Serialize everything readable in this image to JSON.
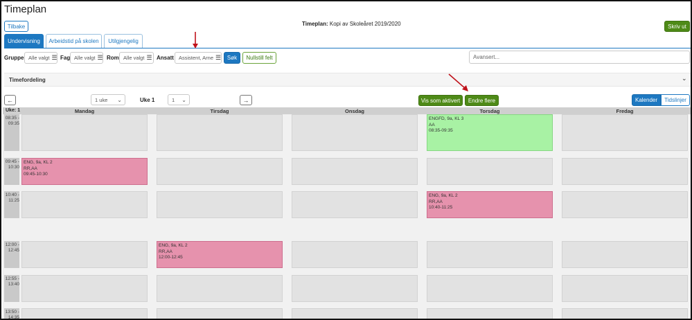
{
  "page": {
    "title": "Timeplan"
  },
  "toolbar": {
    "back": "Tilbake",
    "print": "Skriv ut"
  },
  "plan": {
    "label": "Timeplan:",
    "name": "Kopi av Skoleåret 2019/2020"
  },
  "tabs": [
    {
      "label": "Undervisning",
      "active": true
    },
    {
      "label": "Arbeidstid på skolen",
      "active": false
    },
    {
      "label": "Utilgjengelig",
      "active": false
    }
  ],
  "filters": {
    "gruppe": {
      "label": "Gruppe",
      "value": "Alle valgt"
    },
    "fag": {
      "label": "Fag",
      "value": "Alle valgt"
    },
    "rom": {
      "label": "Rom",
      "value": "Alle valgt"
    },
    "ansatt": {
      "label": "Ansatt",
      "value": "Assistent, Arne"
    },
    "search": "Søk",
    "reset": "Nullstill felt",
    "advanced": "Avansert..."
  },
  "section": {
    "title": "Timefordeling"
  },
  "nav": {
    "prev_icon": "arrow-left-icon",
    "next_icon": "arrow-right-icon",
    "period": "1 uke",
    "week_label": "Uke 1",
    "week_value": "1",
    "show_active": "Vis som aktivert",
    "edit_more": "Endre flere",
    "view_calendar": "Kalender",
    "view_timelines": "Tidslinjer"
  },
  "calendar": {
    "week_header": "Uke: 1",
    "days": [
      "Mandag",
      "Tirsdag",
      "Onsdag",
      "Torsdag",
      "Fredag"
    ],
    "slots": [
      "08:35 - 09:35",
      "09:45 - 10:30",
      "10:40 - 11:25",
      "12:00 - 12:45",
      "12:55 - 13:40",
      "13:50 - 14:35"
    ],
    "events": [
      {
        "lines": [
          "ENGFD, 9a, KL 3",
          "AA",
          "08:35-09:35"
        ],
        "color": "#a8f2a4"
      },
      {
        "lines": [
          "ENG, 9a, KL 2",
          "RR,AA",
          "09:45-10:30"
        ],
        "color": "#e692ad"
      },
      {
        "lines": [
          "ENG, 9a, KL 2",
          "RR,AA",
          "10:40-11:25"
        ],
        "color": "#e692ad"
      },
      {
        "lines": [
          "ENG, 9a, KL 2",
          "RR,AA",
          "12:00-12:45"
        ],
        "color": "#e692ad"
      }
    ]
  },
  "annotations": {
    "arrow_color": "#c0121b"
  },
  "colors": {
    "accent_blue": "#1d78c1",
    "accent_green": "#4e8a17",
    "event_pink": "#e692ad",
    "event_green": "#a8f2a4"
  }
}
